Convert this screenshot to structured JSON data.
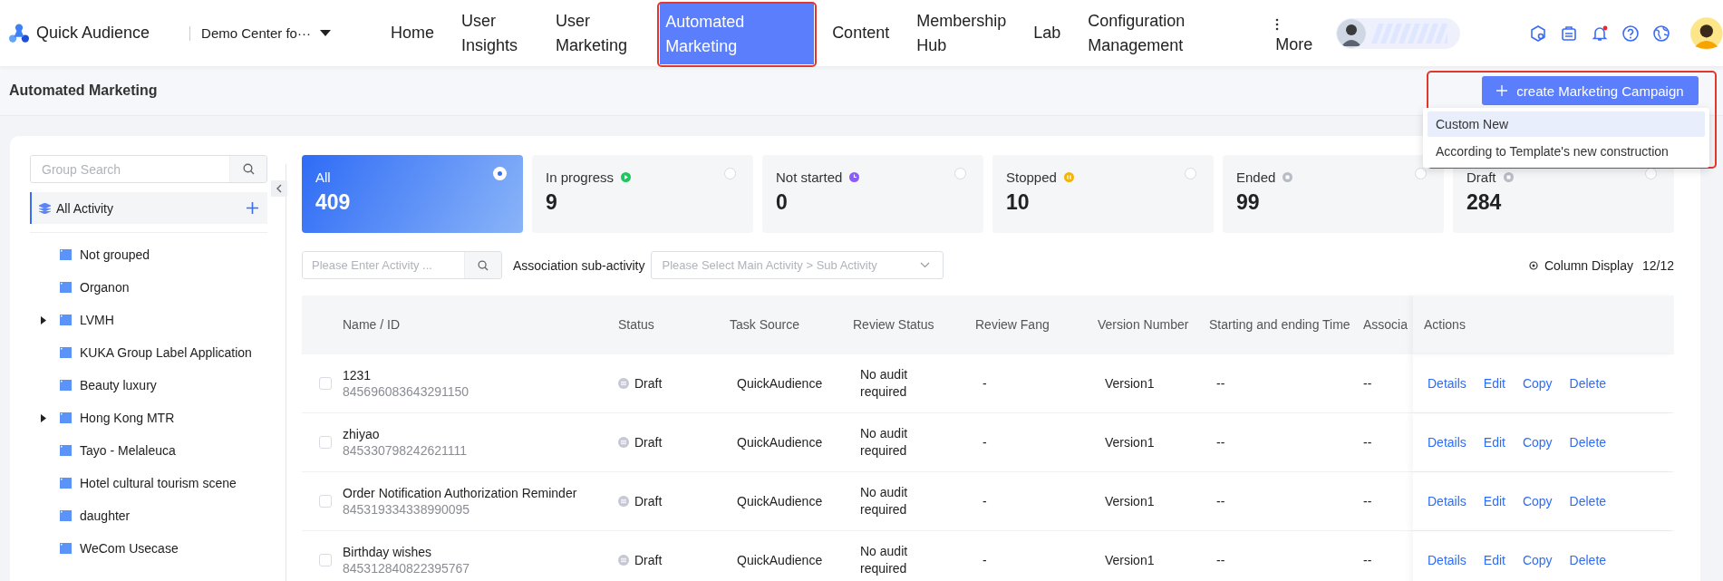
{
  "app": {
    "name": "Quick Audience",
    "workspace": "Demo Center fo···"
  },
  "nav": [
    {
      "label": "Home",
      "selected": false
    },
    {
      "label": "User Insights",
      "selected": false
    },
    {
      "label": "User Marketing",
      "selected": false
    },
    {
      "label": "Automated Marketing",
      "selected": true
    },
    {
      "label": "Content",
      "selected": false
    },
    {
      "label": "Membership Hub",
      "selected": false
    },
    {
      "label": "Lab",
      "selected": false
    },
    {
      "label": "Configuration Management",
      "selected": false
    }
  ],
  "more_label": "More",
  "notifications": {
    "unread": true
  },
  "page_title": "Automated Marketing",
  "create_button": {
    "label": "create Marketing Campaign"
  },
  "create_menu": [
    {
      "label": "Custom New",
      "selected": true
    },
    {
      "label": "According to Template's new construction",
      "selected": false
    }
  ],
  "sidebar": {
    "search": {
      "placeholder": "Group Search"
    },
    "root": {
      "label": "All Activity",
      "selected": true
    },
    "groups": [
      {
        "label": "Not grouped",
        "has_children": false
      },
      {
        "label": "Organon",
        "has_children": false
      },
      {
        "label": "LVMH",
        "has_children": true
      },
      {
        "label": "KUKA Group Label Application",
        "has_children": false
      },
      {
        "label": "Beauty luxury",
        "has_children": false
      },
      {
        "label": "Hong Kong MTR",
        "has_children": true
      },
      {
        "label": "Tayo - Melaleuca",
        "has_children": false
      },
      {
        "label": "Hotel cultural tourism scene",
        "has_children": false
      },
      {
        "label": "daughter",
        "has_children": false
      },
      {
        "label": "WeCom Usecase",
        "has_children": false
      }
    ]
  },
  "status_cards": [
    {
      "kind": "all",
      "label": "All",
      "count": "409",
      "selected": true
    },
    {
      "kind": "running",
      "label": "In progress",
      "count": "9",
      "selected": false,
      "color": "#22c55e"
    },
    {
      "kind": "pending",
      "label": "Not started",
      "count": "0",
      "selected": false,
      "color": "#8b5cf6"
    },
    {
      "kind": "stopped",
      "label": "Stopped",
      "count": "10",
      "selected": false,
      "color": "#f5b400"
    },
    {
      "kind": "ended",
      "label": "Ended",
      "count": "99",
      "selected": false,
      "color": "#b8bcc6"
    },
    {
      "kind": "draft",
      "label": "Draft",
      "count": "284",
      "selected": false,
      "color": "#b8bcc6"
    }
  ],
  "filters": {
    "search": {
      "placeholder": "Please Enter Activity ..."
    },
    "association_label": "Association sub-activity",
    "association_select": {
      "placeholder": "Please Select Main Activity > Sub Activity"
    },
    "column_display": {
      "label": "Column Display",
      "count": "12/12"
    }
  },
  "table": {
    "columns": [
      "Name / ID",
      "Status",
      "Task Source",
      "Review Status",
      "Review Fang",
      "Version Number",
      "Starting and ending Time",
      "Associa",
      "Actions"
    ],
    "rows": [
      {
        "checked": false,
        "name": "1231",
        "id": "845696083643291150",
        "status": "Draft",
        "task_source": "QuickAudience",
        "review_status": "No audit required",
        "review_fang": "-",
        "version": "Version1",
        "time": "--",
        "association": "--",
        "actions": [
          "Details",
          "Edit",
          "Copy",
          "Delete"
        ]
      },
      {
        "checked": false,
        "name": "zhiyao",
        "id": "845330798242621111",
        "status": "Draft",
        "task_source": "QuickAudience",
        "review_status": "No audit required",
        "review_fang": "-",
        "version": "Version1",
        "time": "--",
        "association": "--",
        "actions": [
          "Details",
          "Edit",
          "Copy",
          "Delete"
        ]
      },
      {
        "checked": false,
        "name": "Order Notification Authorization Reminder",
        "id": "845319334338990095",
        "status": "Draft",
        "task_source": "QuickAudience",
        "review_status": "No audit required",
        "review_fang": "-",
        "version": "Version1",
        "time": "--",
        "association": "--",
        "actions": [
          "Details",
          "Edit",
          "Copy",
          "Delete"
        ]
      },
      {
        "checked": false,
        "name": "Birthday wishes",
        "id": "845312840822395767",
        "status": "Draft",
        "task_source": "QuickAudience",
        "review_status": "No audit required",
        "review_fang": "-",
        "version": "Version1",
        "time": "--",
        "association": "--",
        "actions": [
          "Details",
          "Edit",
          "Copy",
          "Delete"
        ]
      }
    ]
  }
}
